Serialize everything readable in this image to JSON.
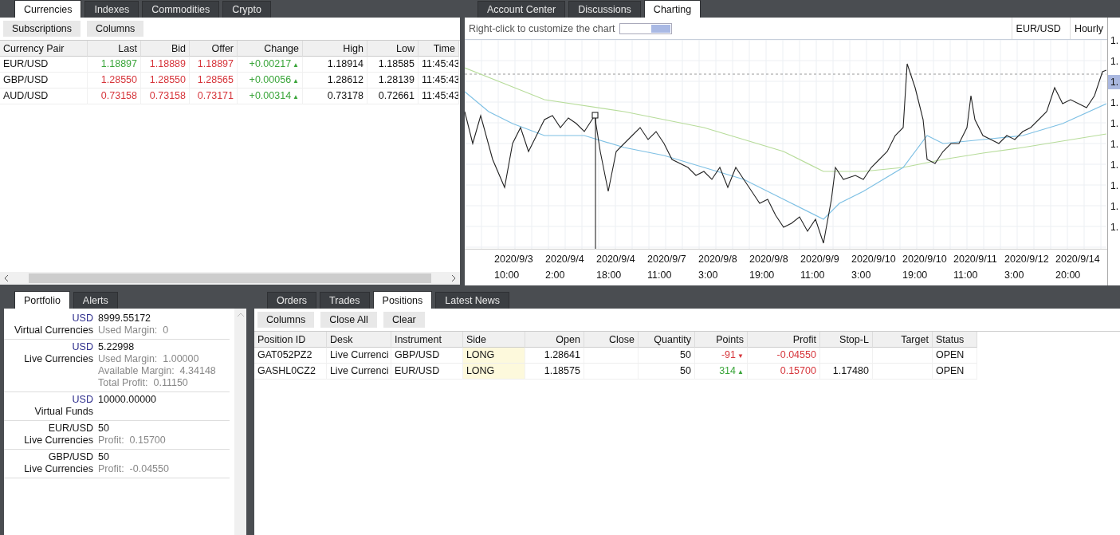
{
  "quotes_panel": {
    "tabs": [
      {
        "label": "Currencies",
        "selected": true
      },
      {
        "label": "Indexes",
        "selected": false
      },
      {
        "label": "Commodities",
        "selected": false
      },
      {
        "label": "Crypto",
        "selected": false
      }
    ],
    "toolbar": [
      "Subscriptions",
      "Columns"
    ],
    "table": {
      "columns": [
        "Currency Pair",
        "Last",
        "Bid",
        "Offer",
        "Change",
        "High",
        "Low",
        "Time"
      ],
      "rows": [
        {
          "cells": [
            {
              "text": "EUR/USD",
              "kind": "plain"
            },
            {
              "text": "1.18897",
              "kind": "up"
            },
            {
              "text": "1.18889",
              "kind": "down"
            },
            {
              "text": "1.18897",
              "kind": "down"
            },
            {
              "text": "+0.00217",
              "kind": "up",
              "arrow": "▲"
            },
            {
              "text": "1.18914",
              "kind": "plain"
            },
            {
              "text": "1.18585",
              "kind": "plain"
            },
            {
              "text": "11:45:43",
              "kind": "plain"
            }
          ]
        },
        {
          "cells": [
            {
              "text": "GBP/USD",
              "kind": "plain"
            },
            {
              "text": "1.28550",
              "kind": "down"
            },
            {
              "text": "1.28550",
              "kind": "down"
            },
            {
              "text": "1.28565",
              "kind": "down"
            },
            {
              "text": "+0.00056",
              "kind": "up",
              "arrow": "▲"
            },
            {
              "text": "1.28612",
              "kind": "plain"
            },
            {
              "text": "1.28139",
              "kind": "plain"
            },
            {
              "text": "11:45:43",
              "kind": "plain"
            }
          ]
        },
        {
          "cells": [
            {
              "text": "AUD/USD",
              "kind": "plain"
            },
            {
              "text": "0.73158",
              "kind": "down"
            },
            {
              "text": "0.73158",
              "kind": "down"
            },
            {
              "text": "0.73171",
              "kind": "down"
            },
            {
              "text": "+0.00314",
              "kind": "up",
              "arrow": "▲"
            },
            {
              "text": "0.73178",
              "kind": "plain"
            },
            {
              "text": "0.72661",
              "kind": "plain"
            },
            {
              "text": "11:45:43",
              "kind": "plain"
            }
          ]
        }
      ]
    }
  },
  "chart_panel": {
    "tabs": [
      {
        "label": "Account Center",
        "selected": false
      },
      {
        "label": "Discussions",
        "selected": false
      },
      {
        "label": "Charting",
        "selected": true
      }
    ],
    "hint": "Right-click to customize the chart",
    "symbol": "EUR/USD",
    "interval": "Hourly",
    "y_axis_labels": [
      {
        "text": "1.",
        "current": false
      },
      {
        "text": "1.",
        "current": false
      },
      {
        "text": "1.",
        "current": true
      },
      {
        "text": "1.",
        "current": false
      },
      {
        "text": "1.",
        "current": false
      },
      {
        "text": "1.",
        "current": false
      },
      {
        "text": "1.",
        "current": false
      },
      {
        "text": "1.",
        "current": false
      },
      {
        "text": "1.",
        "current": false
      },
      {
        "text": "1.",
        "current": false
      }
    ],
    "x_axis_labels": [
      [
        "2020/9/3",
        "10:00"
      ],
      [
        "2020/9/4",
        "2:00"
      ],
      [
        "2020/9/4",
        "18:00"
      ],
      [
        "2020/9/7",
        "11:00"
      ],
      [
        "2020/9/8",
        "3:00"
      ],
      [
        "2020/9/8",
        "19:00"
      ],
      [
        "2020/9/9",
        "11:00"
      ],
      [
        "2020/9/10",
        "3:00"
      ],
      [
        "2020/9/10",
        "19:00"
      ],
      [
        "2020/9/11",
        "11:00"
      ],
      [
        "2020/9/12",
        "3:00"
      ],
      [
        "2020/9/14",
        "20:00"
      ]
    ]
  },
  "portfolio_panel": {
    "tabs": [
      {
        "label": "Portfolio",
        "selected": true
      },
      {
        "label": "Alerts",
        "selected": false
      }
    ],
    "items": [
      {
        "kind": "account",
        "name": "USD",
        "amount": "8999.55172",
        "desk": "Virtual Currencies",
        "details": [
          "Used Margin:  0"
        ]
      },
      {
        "kind": "account",
        "name": "USD",
        "amount": "5.22998",
        "desk": "Live Currencies",
        "details": [
          "Used Margin:  1.00000",
          "Available Margin:  4.34148",
          "Total Profit:  0.11150"
        ]
      },
      {
        "kind": "account",
        "name": "USD",
        "amount": "10000.00000",
        "desk": "Virtual Funds"
      },
      {
        "kind": "position",
        "name": "EUR/USD",
        "amount": "50",
        "desk": "Live Currencies",
        "details": [
          "Profit:  0.15700"
        ]
      },
      {
        "kind": "position",
        "name": "GBP/USD",
        "amount": "50",
        "desk": "Live Currencies",
        "details": [
          "Profit:  -0.04550"
        ]
      }
    ]
  },
  "positions_panel": {
    "tabs": [
      {
        "label": "Orders",
        "selected": false
      },
      {
        "label": "Trades",
        "selected": false
      },
      {
        "label": "Positions",
        "selected": true
      },
      {
        "label": "Latest News",
        "selected": false
      }
    ],
    "toolbar": [
      "Columns",
      "Close All",
      "Clear"
    ],
    "table": {
      "columns": [
        "Position ID",
        "Desk",
        "Instrument",
        "Side",
        "Open",
        "Close",
        "Quantity",
        "Points",
        "Profit",
        "Stop-L",
        "Target",
        "Status"
      ],
      "rows": [
        {
          "cells": [
            {
              "text": "GAT052PZ2",
              "kind": "plain"
            },
            {
              "text": "Live Currenci",
              "kind": "plain"
            },
            {
              "text": "GBP/USD",
              "kind": "plain"
            },
            {
              "text": "LONG",
              "kind": "plain",
              "highlight": true
            },
            {
              "text": "1.28641",
              "kind": "plain"
            },
            {
              "kind": "plain"
            },
            {
              "text": "50",
              "kind": "plain"
            },
            {
              "text": "-91",
              "kind": "down",
              "arrow": "▼"
            },
            {
              "text": "-0.04550",
              "kind": "down"
            },
            {
              "kind": "plain"
            },
            {
              "kind": "plain"
            },
            {
              "text": "OPEN",
              "kind": "plain"
            }
          ]
        },
        {
          "cells": [
            {
              "text": "GASHL0CZ2",
              "kind": "plain"
            },
            {
              "text": "Live Currenci",
              "kind": "plain"
            },
            {
              "text": "EUR/USD",
              "kind": "plain"
            },
            {
              "text": "LONG",
              "kind": "plain",
              "highlight": true
            },
            {
              "text": "1.18575",
              "kind": "plain"
            },
            {
              "kind": "plain"
            },
            {
              "text": "50",
              "kind": "plain"
            },
            {
              "text": "314",
              "kind": "up",
              "arrow": "▲"
            },
            {
              "text": "0.15700",
              "kind": "down"
            },
            {
              "text": "1.17480",
              "kind": "plain"
            },
            {
              "kind": "plain"
            },
            {
              "text": "OPEN",
              "kind": "plain"
            }
          ]
        }
      ]
    }
  }
}
